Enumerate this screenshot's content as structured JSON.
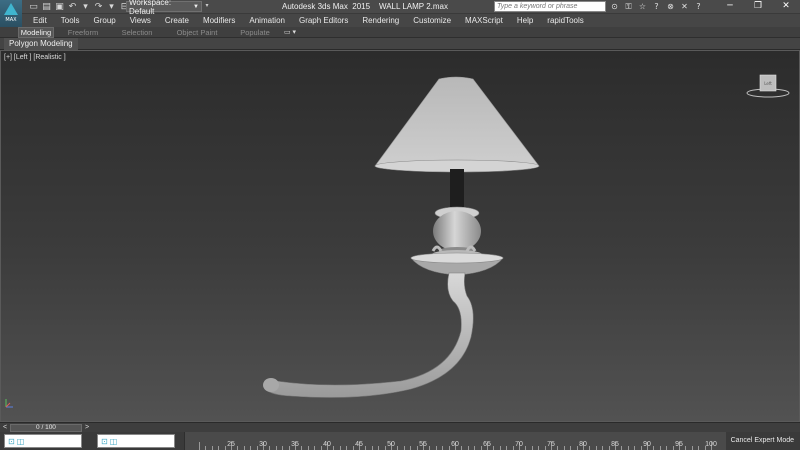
{
  "app": {
    "logo_text": "MAX",
    "title": "Autodesk 3ds Max  2015    WALL LAMP 2.max"
  },
  "quick_access": [
    {
      "icon": "new-file-icon",
      "glyph": "▭"
    },
    {
      "icon": "open-folder-icon",
      "glyph": "▤"
    },
    {
      "icon": "save-icon",
      "glyph": "▣"
    },
    {
      "icon": "undo-icon",
      "glyph": "↶"
    },
    {
      "icon": "dropdown-icon",
      "glyph": "▾"
    },
    {
      "icon": "redo-icon",
      "glyph": "↷"
    },
    {
      "icon": "dropdown-icon",
      "glyph": "▾"
    },
    {
      "icon": "project-folder-icon",
      "glyph": "⊟"
    }
  ],
  "workspace": {
    "label": "Workspace: Default"
  },
  "search": {
    "placeholder": "Type a keyword or phrase"
  },
  "toolbar_icons": [
    {
      "icon": "binoculars-icon",
      "glyph": "⊙"
    },
    {
      "icon": "key-icon",
      "glyph": "⚿"
    },
    {
      "icon": "star-icon",
      "glyph": "☆"
    },
    {
      "icon": "help-icon",
      "glyph": "?"
    },
    {
      "icon": "sign-in-icon",
      "glyph": "⊗"
    },
    {
      "icon": "exchange-icon",
      "glyph": "✕"
    },
    {
      "icon": "help-dropdown-icon",
      "glyph": "?"
    }
  ],
  "window_controls": [
    {
      "icon": "minimize-icon",
      "glyph": "─"
    },
    {
      "icon": "maximize-icon",
      "glyph": "❐"
    },
    {
      "icon": "close-icon",
      "glyph": "✕"
    }
  ],
  "menu": [
    "Edit",
    "Tools",
    "Group",
    "Views",
    "Create",
    "Modifiers",
    "Animation",
    "Graph Editors",
    "Rendering",
    "Customize",
    "MAXScript",
    "Help",
    "rapidTools"
  ],
  "ribbon_tabs": [
    "Modeling",
    "Freeform",
    "Selection",
    "Object Paint",
    "Populate"
  ],
  "ribbon_active": "Modeling",
  "sub_ribbon": {
    "label": "Polygon Modeling"
  },
  "viewport": {
    "label": "[+] [Left ] [Realistic ]",
    "viewcube_label": "Left"
  },
  "timeline": {
    "slider_label": "0 / 100",
    "prev_glyph": "<",
    "next_glyph": ">"
  },
  "ruler_labels": [
    25,
    30,
    35,
    40,
    45,
    50,
    55,
    60,
    65,
    70,
    75,
    80,
    85,
    90,
    95,
    100
  ],
  "status": {
    "cancel_expert": "Cancel Expert Mode"
  },
  "colors": {
    "accent": "#3fb5cf",
    "chrome": "#464646",
    "viewport_top": "#2c2c2c",
    "viewport_bottom": "#525252"
  }
}
